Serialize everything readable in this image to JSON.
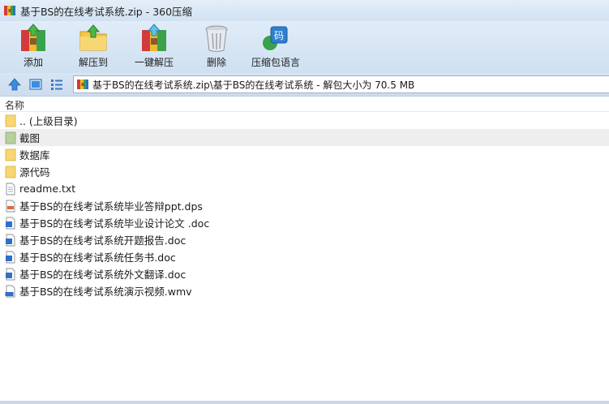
{
  "window": {
    "title": "基于BS的在线考试系统.zip - 360压缩"
  },
  "toolbar": {
    "buttons": [
      {
        "label": "添加",
        "icon": "add-archive-icon"
      },
      {
        "label": "解压到",
        "icon": "extract-to-icon"
      },
      {
        "label": "一键解压",
        "icon": "one-click-extract-icon"
      },
      {
        "label": "删除",
        "icon": "delete-trash-icon"
      },
      {
        "label": "压缩包语言",
        "icon": "archive-language-icon"
      }
    ]
  },
  "address": {
    "path": "基于BS的在线考试系统.zip\\基于BS的在线考试系统 - 解包大小为 70.5 MB"
  },
  "list": {
    "column_name": "名称",
    "rows": [
      {
        "name": ".. (上级目录)",
        "type": "parent-folder"
      },
      {
        "name": "截图",
        "type": "folder-image"
      },
      {
        "name": "数据库",
        "type": "folder"
      },
      {
        "name": "源代码",
        "type": "folder"
      },
      {
        "name": "readme.txt",
        "type": "txt"
      },
      {
        "name": "基于BS的在线考试系统毕业答辩ppt.dps",
        "type": "dps"
      },
      {
        "name": "基于BS的在线考试系统毕业设计论文 .doc",
        "type": "doc"
      },
      {
        "name": "基于BS的在线考试系统开题报告.doc",
        "type": "doc"
      },
      {
        "name": "基于BS的在线考试系统任务书.doc",
        "type": "doc"
      },
      {
        "name": "基于BS的在线考试系统外文翻译.doc",
        "type": "doc"
      },
      {
        "name": "基于BS的在线考试系统演示视频.wmv",
        "type": "wmv"
      }
    ]
  },
  "colors": {
    "accent": "#2a78c8",
    "selected_row": "#eeeeee",
    "folder": "#f7d774"
  }
}
